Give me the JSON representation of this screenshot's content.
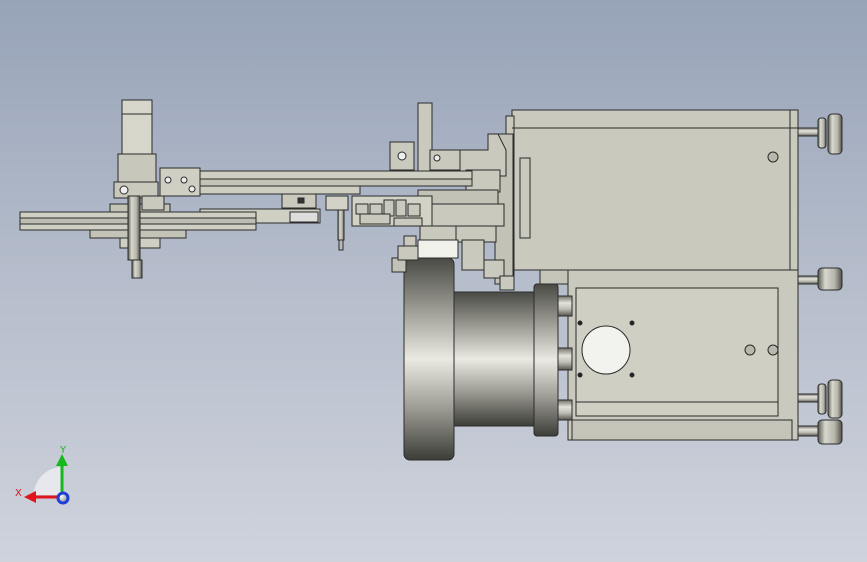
{
  "view": {
    "background_top": "#97a3b8",
    "background_bottom": "#cfd3dc",
    "part_fill": "#c9c9bd",
    "part_stroke": "#2b2b2b"
  },
  "triad": {
    "x_label": "X",
    "y_label": "Y",
    "x_color": "#e0141e",
    "y_color": "#16b81e",
    "z_color": "#1f3fd6"
  }
}
